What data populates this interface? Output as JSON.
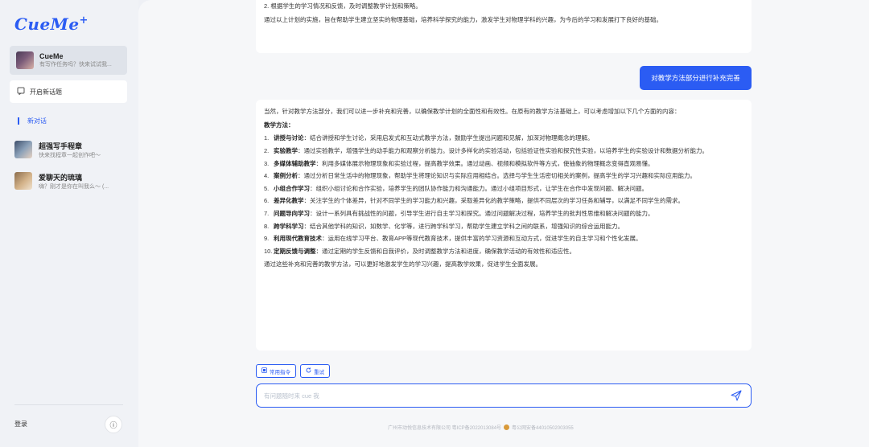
{
  "sidebar": {
    "logo": "CueMe",
    "logo_plus": "+",
    "current_agent": {
      "name": "CueMe",
      "subtitle": "有写作任务吗？快来试试我..."
    },
    "new_topic": "开启新话题",
    "section_label": "新对话",
    "conversations": [
      {
        "name": "超强写手程章",
        "subtitle": "快来找程章一起创作吧～"
      },
      {
        "name": "爱聊天的琉璃",
        "subtitle": "嗨？刚才是你在叫我么～ (..."
      }
    ],
    "login": "登录",
    "info_icon": "ⓘ"
  },
  "chat": {
    "prev_lines": [
      "2. 根据学生的学习情况和反馈，及时调整教学计划和策略。",
      "通过以上计划的实施，旨在帮助学生建立坚实的物理基础，培养科学探究的能力，激发学生对物理学科的兴趣，为今后的学习和发展打下良好的基础。"
    ],
    "user_message": "对教学方法部分进行补充完善",
    "answer_intro": "当然，针对教学方法部分，我们可以进一步补充和完善，以确保教学计划的全面性和有效性。在原有的教学方法基础上，可以考虑增加以下几个方面的内容：",
    "answer_heading": "教学方法：",
    "items": [
      {
        "num": "1.",
        "title": "讲授与讨论",
        "text": "：结合讲授和学生讨论，采用启发式和互动式教学方法，鼓励学生提出问题和见解，加深对物理概念的理解。"
      },
      {
        "num": "2.",
        "title": "实验教学",
        "text": "：通过实验教学，增强学生的动手能力和观察分析能力。设计多样化的实验活动，包括验证性实验和探究性实验，以培养学生的实验设计和数据分析能力。"
      },
      {
        "num": "3.",
        "title": "多媒体辅助教学",
        "text": "：利用多媒体展示物理现象和实验过程，提高教学效果。通过动画、视频和模拟软件等方式，使抽象的物理概念变得直观易懂。"
      },
      {
        "num": "4.",
        "title": "案例分析",
        "text": "：通过分析日常生活中的物理现象，帮助学生将理论知识与实际应用相结合。选择与学生生活密切相关的案例，提高学生的学习兴趣和实际应用能力。"
      },
      {
        "num": "5.",
        "title": "小组合作学习",
        "text": "：组织小组讨论和合作实验，培养学生的团队协作能力和沟通能力。通过小组项目形式，让学生在合作中发现问题、解决问题。"
      },
      {
        "num": "6.",
        "title": "差异化教学",
        "text": "：关注学生的个体差异，针对不同学生的学习能力和兴趣，采取差异化的教学策略，提供不同层次的学习任务和辅导，以满足不同学生的需求。"
      },
      {
        "num": "7.",
        "title": "问题导向学习",
        "text": "：设计一系列具有挑战性的问题，引导学生进行自主学习和探究。通过问题解决过程，培养学生的批判性思维和解决问题的能力。"
      },
      {
        "num": "8.",
        "title": "跨学科学习",
        "text": "：结合其他学科的知识，如数学、化学等，进行跨学科学习，帮助学生建立学科之间的联系，增强知识的综合运用能力。"
      },
      {
        "num": "9.",
        "title": "利用现代教育技术",
        "text": "：运用在线学习平台、教育APP等现代教育技术，提供丰富的学习资源和互动方式，促进学生的自主学习和个性化发展。"
      },
      {
        "num": "10.",
        "title": "定期反馈与调整",
        "text": "：通过定期的学生反馈和自我评价，及时调整教学方法和进度，确保教学活动的有效性和适应性。"
      }
    ],
    "answer_outro": "通过这些补充和完善的教学方法，可以更好地激发学生的学习兴趣，提高教学效果，促进学生全面发展。"
  },
  "composer": {
    "chip_commands": "常用指令",
    "chip_retry": "重试",
    "placeholder": "有问题随时来 cue 我"
  },
  "footer": {
    "icp": "广州市动悦信息技术有限公司 粤ICP备2022013084号",
    "police": "粤公网安备44010502003055"
  },
  "colors": {
    "accent": "#2b5cf3"
  }
}
